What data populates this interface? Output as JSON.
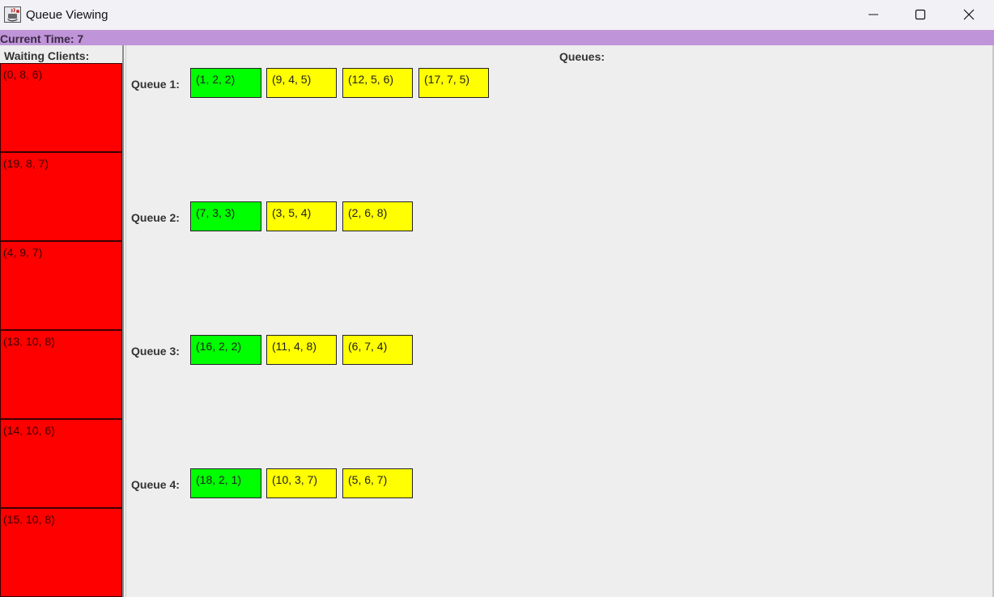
{
  "window": {
    "title": "Queue Viewing",
    "icon": "java-cup-icon",
    "controls": [
      "minimize-icon",
      "maximize-icon",
      "close-icon"
    ]
  },
  "time_bar": {
    "label": "Current Time: 7",
    "color": "#bf94d8"
  },
  "waiting": {
    "title": "Waiting Clients:",
    "color": "#ff0000",
    "clients": [
      "(0, 8, 6)",
      "(19, 8, 7)",
      "(4, 9, 7)",
      "(13, 10, 8)",
      "(14, 10, 6)",
      "(15, 10, 8)"
    ]
  },
  "queues_panel": {
    "title": "Queues:",
    "active_color": "#00ff00",
    "pending_color": "#ffff00",
    "queues": [
      {
        "label": "Queue 1:",
        "tasks": [
          "(1, 2, 2)",
          "(9, 4, 5)",
          "(12, 5, 6)",
          "(17, 7, 5)"
        ]
      },
      {
        "label": "Queue 2:",
        "tasks": [
          "(7, 3, 3)",
          "(3, 5, 4)",
          "(2, 6, 8)"
        ]
      },
      {
        "label": "Queue 3:",
        "tasks": [
          "(16, 2, 2)",
          "(11, 4, 8)",
          "(6, 7, 4)"
        ]
      },
      {
        "label": "Queue 4:",
        "tasks": [
          "(18, 2, 1)",
          "(10, 3, 7)",
          "(5, 6, 7)"
        ]
      }
    ]
  }
}
